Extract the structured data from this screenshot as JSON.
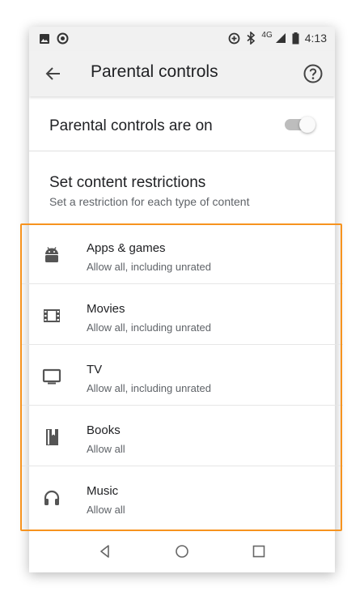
{
  "status_bar": {
    "left_icons": [
      "image-icon",
      "data-saver-icon"
    ],
    "right_icons": [
      "data-saver-plus-icon",
      "bluetooth-icon",
      "signal-icon",
      "battery-icon"
    ],
    "network": "4G",
    "time": "4:13"
  },
  "app_bar": {
    "title": "Parental controls",
    "back_icon": "arrow-back-icon",
    "help_icon": "help-icon"
  },
  "toggle_row": {
    "label": "Parental controls are on",
    "state": "on"
  },
  "restrictions": {
    "title": "Set content restrictions",
    "subtitle": "Set a restriction for each type of content"
  },
  "categories": [
    {
      "icon": "android-icon",
      "name": "Apps & games",
      "value": "Allow all, including unrated"
    },
    {
      "icon": "film-icon",
      "name": "Movies",
      "value": "Allow all, including unrated"
    },
    {
      "icon": "tv-icon",
      "name": "TV",
      "value": "Allow all, including unrated"
    },
    {
      "icon": "book-icon",
      "name": "Books",
      "value": "Allow all"
    },
    {
      "icon": "headphones-icon",
      "name": "Music",
      "value": "Allow all"
    }
  ],
  "highlight_color": "#f7931e",
  "nav_bar": [
    "back-triangle-icon",
    "home-circle-icon",
    "recents-square-icon"
  ]
}
